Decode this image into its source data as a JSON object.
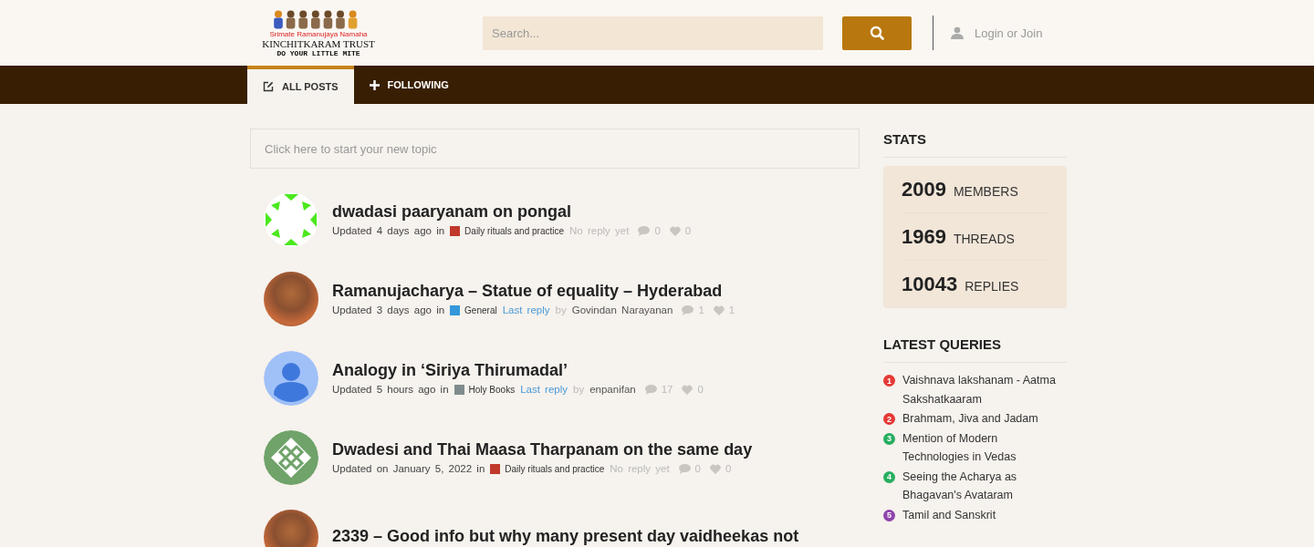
{
  "header": {
    "logo": {
      "tagline_small": "Srimate Ramanujaya Namaha",
      "title": "KINCHITKARAM TRUST",
      "motto": "DO YOUR LITTLE MITE"
    },
    "search": {
      "placeholder": "Search..."
    },
    "login": "Login or Join"
  },
  "tabs": [
    {
      "label": "ALL POSTS",
      "kind": "edit",
      "selected": true
    },
    {
      "label": "FOLLOWING",
      "kind": "plus",
      "selected": false
    }
  ],
  "new_topic": {
    "placeholder": "Click here to start your new topic"
  },
  "topics": [
    {
      "title": "dwadasi paaryanam on pongal",
      "kind": "pattern-arrows",
      "updated": "Updated 4 days ago in",
      "category": "Daily rituals and practice",
      "color": "#c0392b",
      "reply": {
        "kind": "none",
        "text": "No reply yet"
      },
      "replies": "0",
      "likes": "0"
    },
    {
      "title": "Ramanujacharya – Statue of equality – Hyderabad",
      "kind": "photo",
      "updated": "Updated 3 days ago in",
      "category": "General",
      "color": "#3498db",
      "reply": {
        "kind": "last",
        "link": "Last reply",
        "by": "by",
        "user": "Govindan Narayanan"
      },
      "replies": "1",
      "likes": "1"
    },
    {
      "title": "Analogy in ‘Siriya Thirumadal’",
      "kind": "person",
      "updated": "Updated 5 hours ago in",
      "category": "Holy Books",
      "color": "#7f8c8d",
      "reply": {
        "kind": "last",
        "link": "Last reply",
        "by": "by",
        "user": "enpanifan"
      },
      "replies": "17",
      "likes": "0"
    },
    {
      "title": "Dwadesi and Thai Maasa Tharpanam on the same day",
      "kind": "pattern-diamonds",
      "updated": "Updated on January 5, 2022 in",
      "category": "Daily rituals and practice",
      "color": "#c0392b",
      "reply": {
        "kind": "none",
        "text": "No reply yet"
      },
      "replies": "0",
      "likes": "0"
    },
    {
      "title": "2339 – Good info but why many present day vaidheekas not",
      "kind": "photo"
    }
  ],
  "stats": {
    "title": "STATS",
    "items": [
      {
        "number": "2009",
        "label": "MEMBERS"
      },
      {
        "number": "1969",
        "label": "THREADS"
      },
      {
        "number": "10043",
        "label": "REPLIES"
      }
    ]
  },
  "latest_queries": {
    "title": "LATEST QUERIES",
    "items": [
      {
        "number": "1",
        "text": "Vaishnava lakshanam - Aatma Sakshatkaaram",
        "color": "#e53935"
      },
      {
        "number": "2",
        "text": "Brahmam, Jiva and Jadam",
        "color": "#e53935"
      },
      {
        "number": "3",
        "text": "Mention of Modern Technologies in Vedas",
        "color": "#27ae60"
      },
      {
        "number": "4",
        "text": "Seeing the Acharya as Bhagavan's Avataram",
        "color": "#27ae60"
      },
      {
        "number": "5",
        "text": "Tamil and Sanskrit",
        "color": "#8e44ad"
      }
    ]
  }
}
